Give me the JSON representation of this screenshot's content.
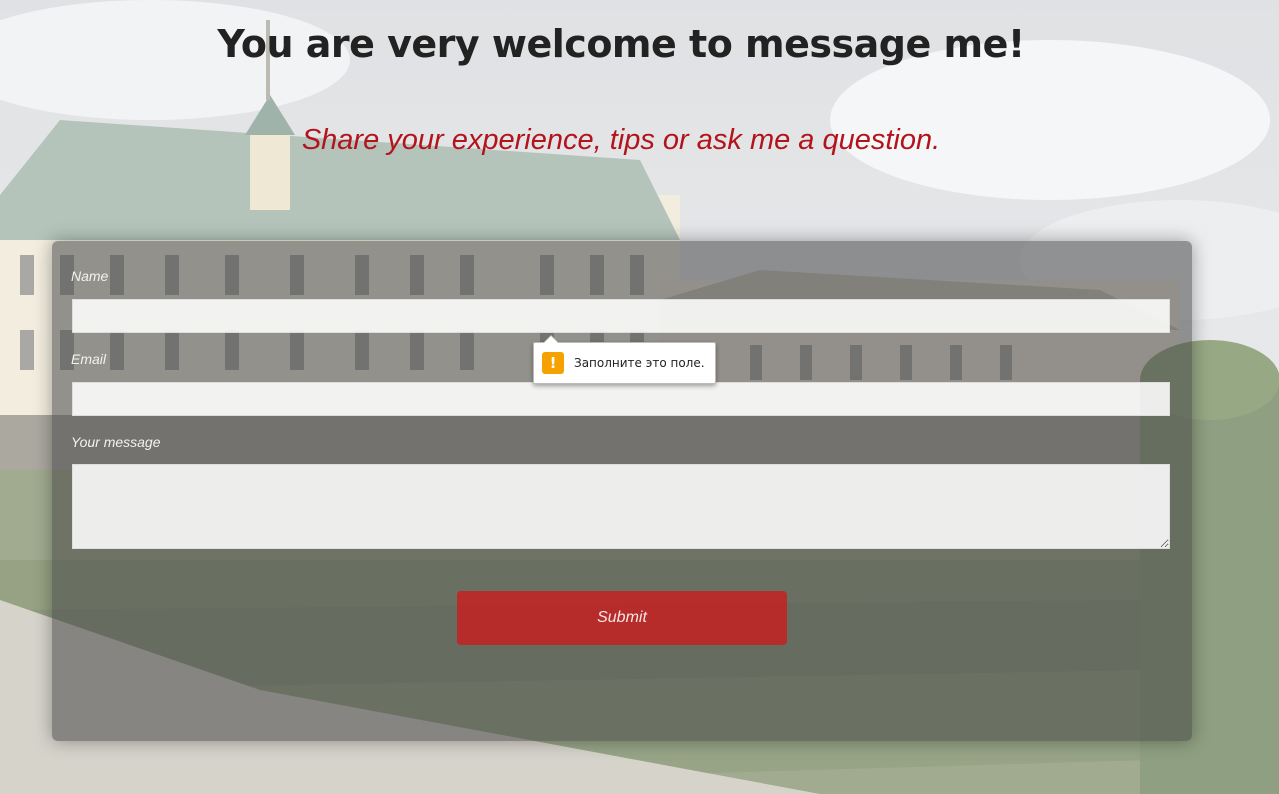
{
  "header": {
    "title": "You are very welcome to message me!",
    "subtitle": "Share your experience, tips or ask me a question."
  },
  "form": {
    "name_label": "Name",
    "name_value": "",
    "email_label": "Email",
    "email_value": "",
    "message_label": "Your message",
    "message_value": "",
    "submit_label": "Submit"
  },
  "validation_tooltip": {
    "icon": "warning-icon",
    "message": "Заполните это поле."
  },
  "colors": {
    "title": "#222222",
    "subtitle": "#b3141c",
    "submit_button": "#c81e1e",
    "warning": "#f5a100"
  }
}
